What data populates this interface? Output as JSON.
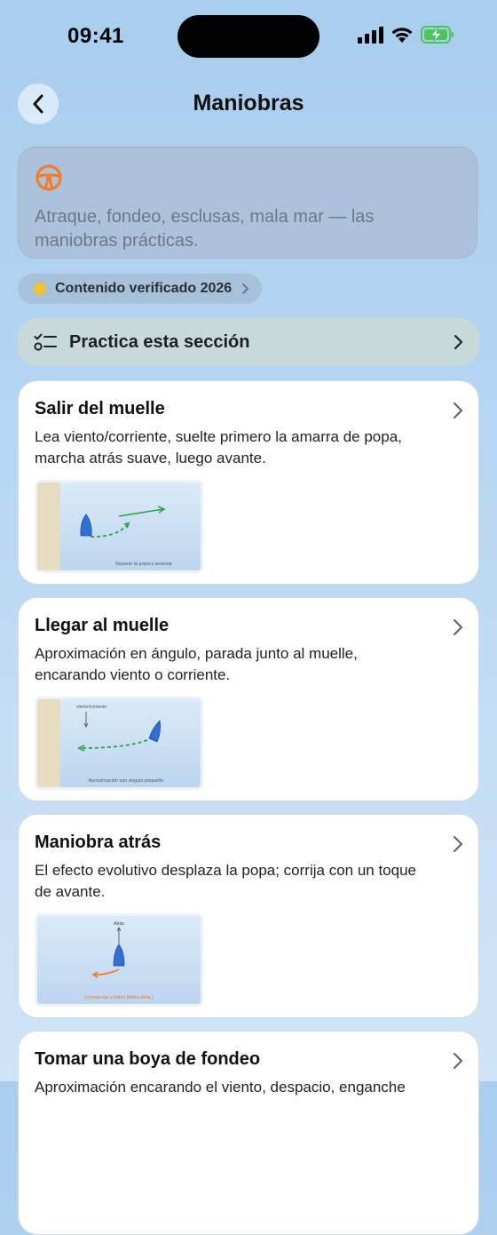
{
  "status_bar": {
    "time": "09:41"
  },
  "header": {
    "title": "Maniobras"
  },
  "intro": {
    "icon": "steering-wheel-icon",
    "text": "Atraque, fondeo, esclusas, mala mar — las maniobras prácticas."
  },
  "badge": {
    "label": "Contenido verificado 2026"
  },
  "practice": {
    "label": "Practica esta sección"
  },
  "cards": [
    {
      "title": "Salir del muelle",
      "description": "Lea viento/corriente, suelte primero la amarra de popa, marcha atrás suave, luego avante.",
      "diagram_caption": "Separar la popa y avanzar"
    },
    {
      "title": "Llegar al muelle",
      "description": "Aproximación en ángulo, parada junto al muelle, encarando viento o corriente.",
      "diagram_caption": "Aproximación con ángulo pequeño",
      "diagram_label": "viento/corriente"
    },
    {
      "title": "Maniobra atrás",
      "description": "El efecto evolutivo desplaza la popa; corrija con un toque de avante.",
      "diagram_caption": "La popa cae a babor (hélice dcha.)",
      "diagram_label": "Atrás"
    },
    {
      "title": "Tomar una boya de fondeo",
      "description": "Aproximación encarando el viento, despacio, enganche"
    }
  ],
  "colors": {
    "accent_orange": "#f07d2e",
    "boat_blue": "#2f6fd6",
    "arrow_green": "#2aa14a",
    "dock_sand": "#e8dcc0"
  }
}
